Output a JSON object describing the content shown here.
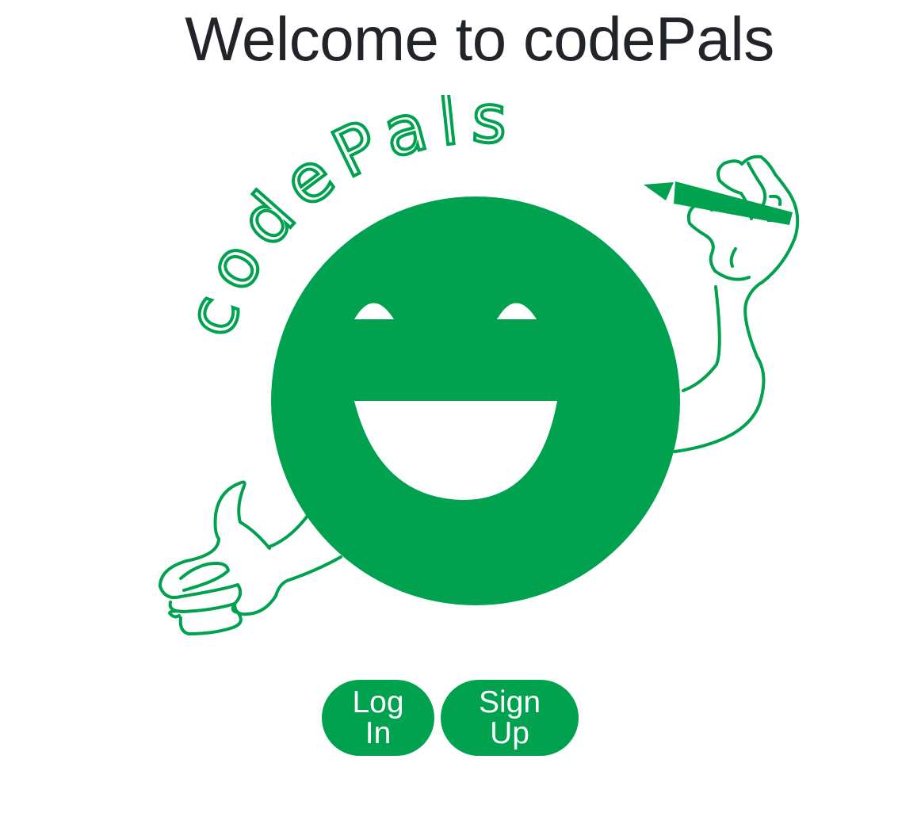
{
  "header": {
    "title": "Welcome to codePals"
  },
  "logo": {
    "wordmark": "codePals",
    "brand_color": "#00a14f",
    "icon": "smiling-mascot-icon"
  },
  "actions": {
    "login_label": "Log In",
    "signup_label": "Sign Up"
  }
}
